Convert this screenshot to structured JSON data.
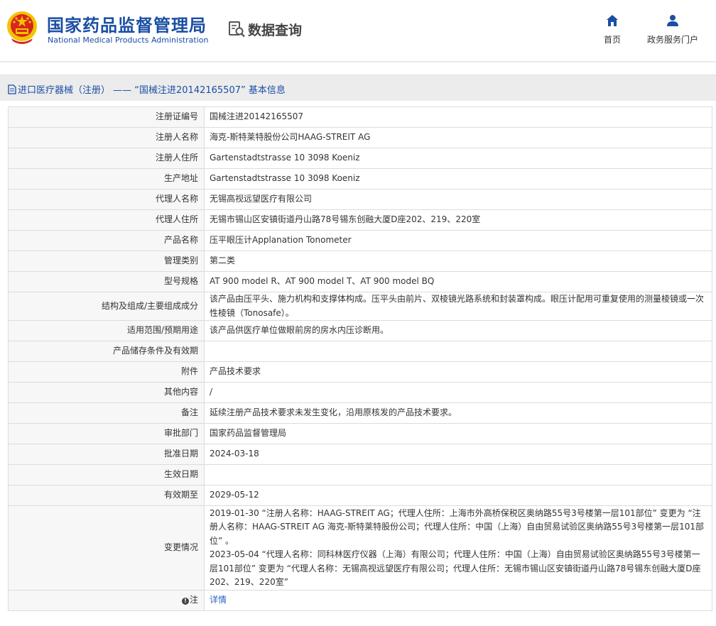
{
  "header": {
    "logo_cn": "国家药品监督管理局",
    "logo_en": "National Medical Products Administration",
    "query_label": "数据查询",
    "nav": [
      {
        "label": "首页",
        "icon": "home-icon"
      },
      {
        "label": "政务服务门户",
        "icon": "user-icon"
      }
    ]
  },
  "breadcrumb": {
    "icon": "document-icon",
    "text": "进口医疗器械（注册） —— “国械注进20142165507” 基本信息"
  },
  "colors": {
    "brand_blue": "#1a4ea3",
    "link_blue": "#2a62c9",
    "bar_gray": "#ececec",
    "emblem_red": "#d7261e",
    "emblem_gold": "#f2c300"
  },
  "rows": [
    {
      "label": "注册证编号",
      "value": "国械注进20142165507"
    },
    {
      "label": "注册人名称",
      "value": "海克-斯特莱特股份公司HAAG-STREIT AG"
    },
    {
      "label": "注册人住所",
      "value": "Gartenstadtstrasse 10 3098 Koeniz"
    },
    {
      "label": "生产地址",
      "value": "Gartenstadtstrasse 10 3098 Koeniz"
    },
    {
      "label": "代理人名称",
      "value": "无锡高视远望医疗有限公司"
    },
    {
      "label": "代理人住所",
      "value": "无锡市锡山区安镇街道丹山路78号锡东创融大厦D座202、219、220室"
    },
    {
      "label": "产品名称",
      "value": "压平眼压计Applanation Tonometer"
    },
    {
      "label": "管理类别",
      "value": "第二类"
    },
    {
      "label": "型号规格",
      "value": "AT 900 model R、AT 900 model T、AT 900 model BQ"
    },
    {
      "label": "结构及组成/主要组成成分",
      "value": "该产品由压平头、施力机构和支撑体构成。压平头由前片、双棱镜光路系统和封装罩构成。眼压计配用可重复使用的测量棱镜或一次性棱镜（Tonosafe）。"
    },
    {
      "label": "适用范围/预期用途",
      "value": "该产品供医疗单位做眼前房的房水内压诊断用。"
    },
    {
      "label": "产品储存条件及有效期",
      "value": ""
    },
    {
      "label": "附件",
      "value": "产品技术要求"
    },
    {
      "label": "其他内容",
      "value": "/"
    },
    {
      "label": "备注",
      "value": "延续注册产品技术要求未发生变化，沿用原核发的产品技术要求。"
    },
    {
      "label": "审批部门",
      "value": "国家药品监督管理局"
    },
    {
      "label": "批准日期",
      "value": "2024-03-18"
    },
    {
      "label": "生效日期",
      "value": ""
    },
    {
      "label": "有效期至",
      "value": "2029-05-12"
    },
    {
      "label": "变更情况",
      "value": "2019-01-30 “注册人名称：HAAG-STREIT AG；代理人住所：上海市外高桥保税区奥纳路55号3号楼第一层101部位” 变更为 “注册人名称：HAAG-STREIT AG 海克-斯特莱特股份公司；代理人住所：中国（上海）自由贸易试验区奥纳路55号3号楼第一层101部位” 。2023-05-04 “代理人名称：同科林医疗仪器（上海）有限公司；代理人住所：中国（上海）自由贸易试验区奥纳路55号3号楼第一层101部位” 变更为 “代理人名称：无锡高视远望医疗有限公司；代理人住所：无锡市锡山区安镇街道丹山路78号锡东创融大厦D座202、219、220室”"
    }
  ],
  "changes": [
    {
      "text": "2019-01-30 “注册人名称：HAAG-STREIT AG；代理人住所：上海市外高桥保税区奥纳路55号3号楼第一层101部位” 变更为 “注册人名称：HAAG-STREIT AG 海克-斯特莱特股份公司；代理人住所：中国（上海）自由贸易试验区奥纳路55号3号楼第一层101部位” 。"
    },
    {
      "text": "2023-05-04 “代理人名称：同科林医疗仪器（上海）有限公司；代理人住所：中国（上海）自由贸易试验区奥纳路55号3号楼第一层101部位” 变更为 “代理人名称：无锡高视远望医疗有限公司；代理人住所：无锡市锡山区安镇街道丹山路78号锡东创融大厦D座202、219、220室”"
    }
  ],
  "note_row": {
    "label": "注",
    "icon": "warning-icon",
    "link": "详情"
  }
}
